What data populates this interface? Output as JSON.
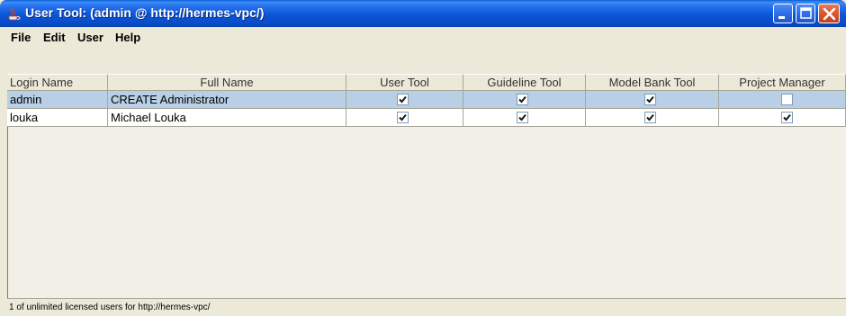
{
  "window": {
    "title": "User Tool: (admin @ http://hermes-vpc/)"
  },
  "menu": {
    "items": [
      "File",
      "Edit",
      "User",
      "Help"
    ]
  },
  "table": {
    "columns": [
      "Login Name",
      "Full Name",
      "User Tool",
      "Guideline Tool",
      "Model Bank Tool",
      "Project Manager"
    ],
    "rows": [
      {
        "login": "admin",
        "full_name": "CREATE Administrator",
        "user_tool": true,
        "guideline_tool": true,
        "model_bank_tool": true,
        "project_manager": false,
        "selected": true
      },
      {
        "login": "louka",
        "full_name": "Michael Louka",
        "user_tool": true,
        "guideline_tool": true,
        "model_bank_tool": true,
        "project_manager": true,
        "selected": false
      }
    ]
  },
  "status": {
    "text": "1 of unlimited licensed users for http://hermes-vpc/"
  },
  "colors": {
    "title_bar": "#0a55d6",
    "selected_row": "#b8cfe5",
    "close_button": "#d9572f"
  },
  "icons": {
    "window": "java-coffee-icon",
    "minimize": "minimize-icon",
    "maximize": "maximize-icon",
    "close": "close-icon",
    "check": "check-icon"
  }
}
